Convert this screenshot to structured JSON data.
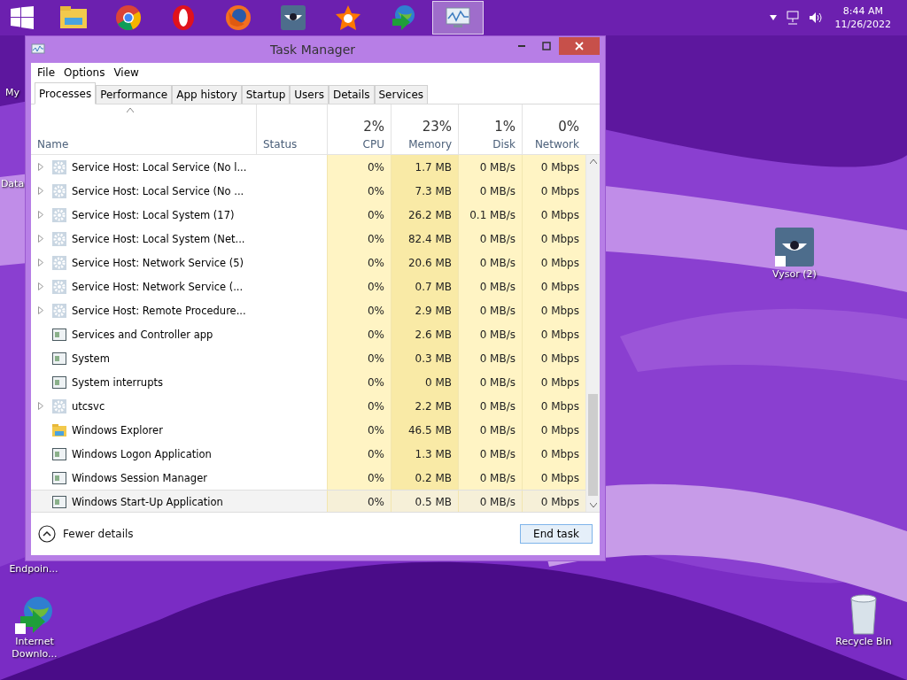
{
  "taskbar": {
    "apps": [
      {
        "kind": "start",
        "active": false
      },
      {
        "kind": "folder",
        "active": false
      },
      {
        "kind": "chrome",
        "active": false
      },
      {
        "kind": "opera",
        "active": false
      },
      {
        "kind": "firefox",
        "active": false
      },
      {
        "kind": "eye",
        "active": false
      },
      {
        "kind": "avast",
        "active": false
      },
      {
        "kind": "globe",
        "active": false
      },
      {
        "kind": "monitor",
        "active": true
      }
    ],
    "time": "8:44 AM",
    "date": "11/26/2022"
  },
  "desktop_icons": [
    {
      "label": "My",
      "kind": "partial"
    },
    {
      "label": "Data",
      "kind": "partial"
    },
    {
      "label": "Endpoin...",
      "kind": "partial"
    },
    {
      "label": "Internet Downlo...",
      "kind": "globe"
    },
    {
      "label": "Vysor (2)",
      "kind": "eye"
    },
    {
      "label": "Recycle Bin",
      "kind": "bin"
    }
  ],
  "window": {
    "title": "Task Manager",
    "menu": [
      "File",
      "Options",
      "View"
    ],
    "tabs": [
      {
        "label": "Processes",
        "selected": true
      },
      {
        "label": "Performance",
        "selected": false
      },
      {
        "label": "App history",
        "selected": false
      },
      {
        "label": "Startup",
        "selected": false
      },
      {
        "label": "Users",
        "selected": false
      },
      {
        "label": "Details",
        "selected": false
      },
      {
        "label": "Services",
        "selected": false
      }
    ],
    "columns": [
      {
        "label": "Name"
      },
      {
        "label": "Status"
      },
      {
        "label": "CPU",
        "total": "2%"
      },
      {
        "label": "Memory",
        "total": "23%"
      },
      {
        "label": "Disk",
        "total": "1%"
      },
      {
        "label": "Network",
        "total": "0%"
      }
    ],
    "rows": [
      {
        "kind": "service",
        "expandable": true,
        "selected": false,
        "cells": [
          "Service Host: Local Service (No l...",
          "",
          "0%",
          "1.7 MB",
          "0 MB/s",
          "0 Mbps"
        ]
      },
      {
        "kind": "service",
        "expandable": true,
        "selected": false,
        "cells": [
          "Service Host: Local Service (No ...",
          "",
          "0%",
          "7.3 MB",
          "0 MB/s",
          "0 Mbps"
        ]
      },
      {
        "kind": "service",
        "expandable": true,
        "selected": false,
        "cells": [
          "Service Host: Local System (17)",
          "",
          "0%",
          "26.2 MB",
          "0.1 MB/s",
          "0 Mbps"
        ]
      },
      {
        "kind": "service",
        "expandable": true,
        "selected": false,
        "cells": [
          "Service Host: Local System (Net...",
          "",
          "0%",
          "82.4 MB",
          "0 MB/s",
          "0 Mbps"
        ]
      },
      {
        "kind": "service",
        "expandable": true,
        "selected": false,
        "cells": [
          "Service Host: Network Service (5)",
          "",
          "0%",
          "20.6 MB",
          "0 MB/s",
          "0 Mbps"
        ]
      },
      {
        "kind": "service",
        "expandable": true,
        "selected": false,
        "cells": [
          "Service Host: Network Service (...",
          "",
          "0%",
          "0.7 MB",
          "0 MB/s",
          "0 Mbps"
        ]
      },
      {
        "kind": "service",
        "expandable": true,
        "selected": false,
        "cells": [
          "Service Host: Remote Procedure...",
          "",
          "0%",
          "2.9 MB",
          "0 MB/s",
          "0 Mbps"
        ]
      },
      {
        "kind": "app",
        "expandable": false,
        "selected": false,
        "cells": [
          "Services and Controller app",
          "",
          "0%",
          "2.6 MB",
          "0 MB/s",
          "0 Mbps"
        ]
      },
      {
        "kind": "app",
        "expandable": false,
        "selected": false,
        "cells": [
          "System",
          "",
          "0%",
          "0.3 MB",
          "0 MB/s",
          "0 Mbps"
        ]
      },
      {
        "kind": "app",
        "expandable": false,
        "selected": false,
        "cells": [
          "System interrupts",
          "",
          "0%",
          "0 MB",
          "0 MB/s",
          "0 Mbps"
        ]
      },
      {
        "kind": "service",
        "expandable": true,
        "selected": false,
        "cells": [
          "utcsvc",
          "",
          "0%",
          "2.2 MB",
          "0 MB/s",
          "0 Mbps"
        ]
      },
      {
        "kind": "folder",
        "expandable": false,
        "selected": false,
        "cells": [
          "Windows Explorer",
          "",
          "0%",
          "46.5 MB",
          "0 MB/s",
          "0 Mbps"
        ]
      },
      {
        "kind": "app",
        "expandable": false,
        "selected": false,
        "cells": [
          "Windows Logon Application",
          "",
          "0%",
          "1.3 MB",
          "0 MB/s",
          "0 Mbps"
        ]
      },
      {
        "kind": "app",
        "expandable": false,
        "selected": false,
        "cells": [
          "Windows Session Manager",
          "",
          "0%",
          "0.2 MB",
          "0 MB/s",
          "0 Mbps"
        ]
      },
      {
        "kind": "app",
        "expandable": false,
        "selected": true,
        "cells": [
          "Windows Start-Up Application",
          "",
          "0%",
          "0.5 MB",
          "0 MB/s",
          "0 Mbps"
        ]
      }
    ],
    "fewer_details": "Fewer details",
    "end_task": "End task"
  }
}
